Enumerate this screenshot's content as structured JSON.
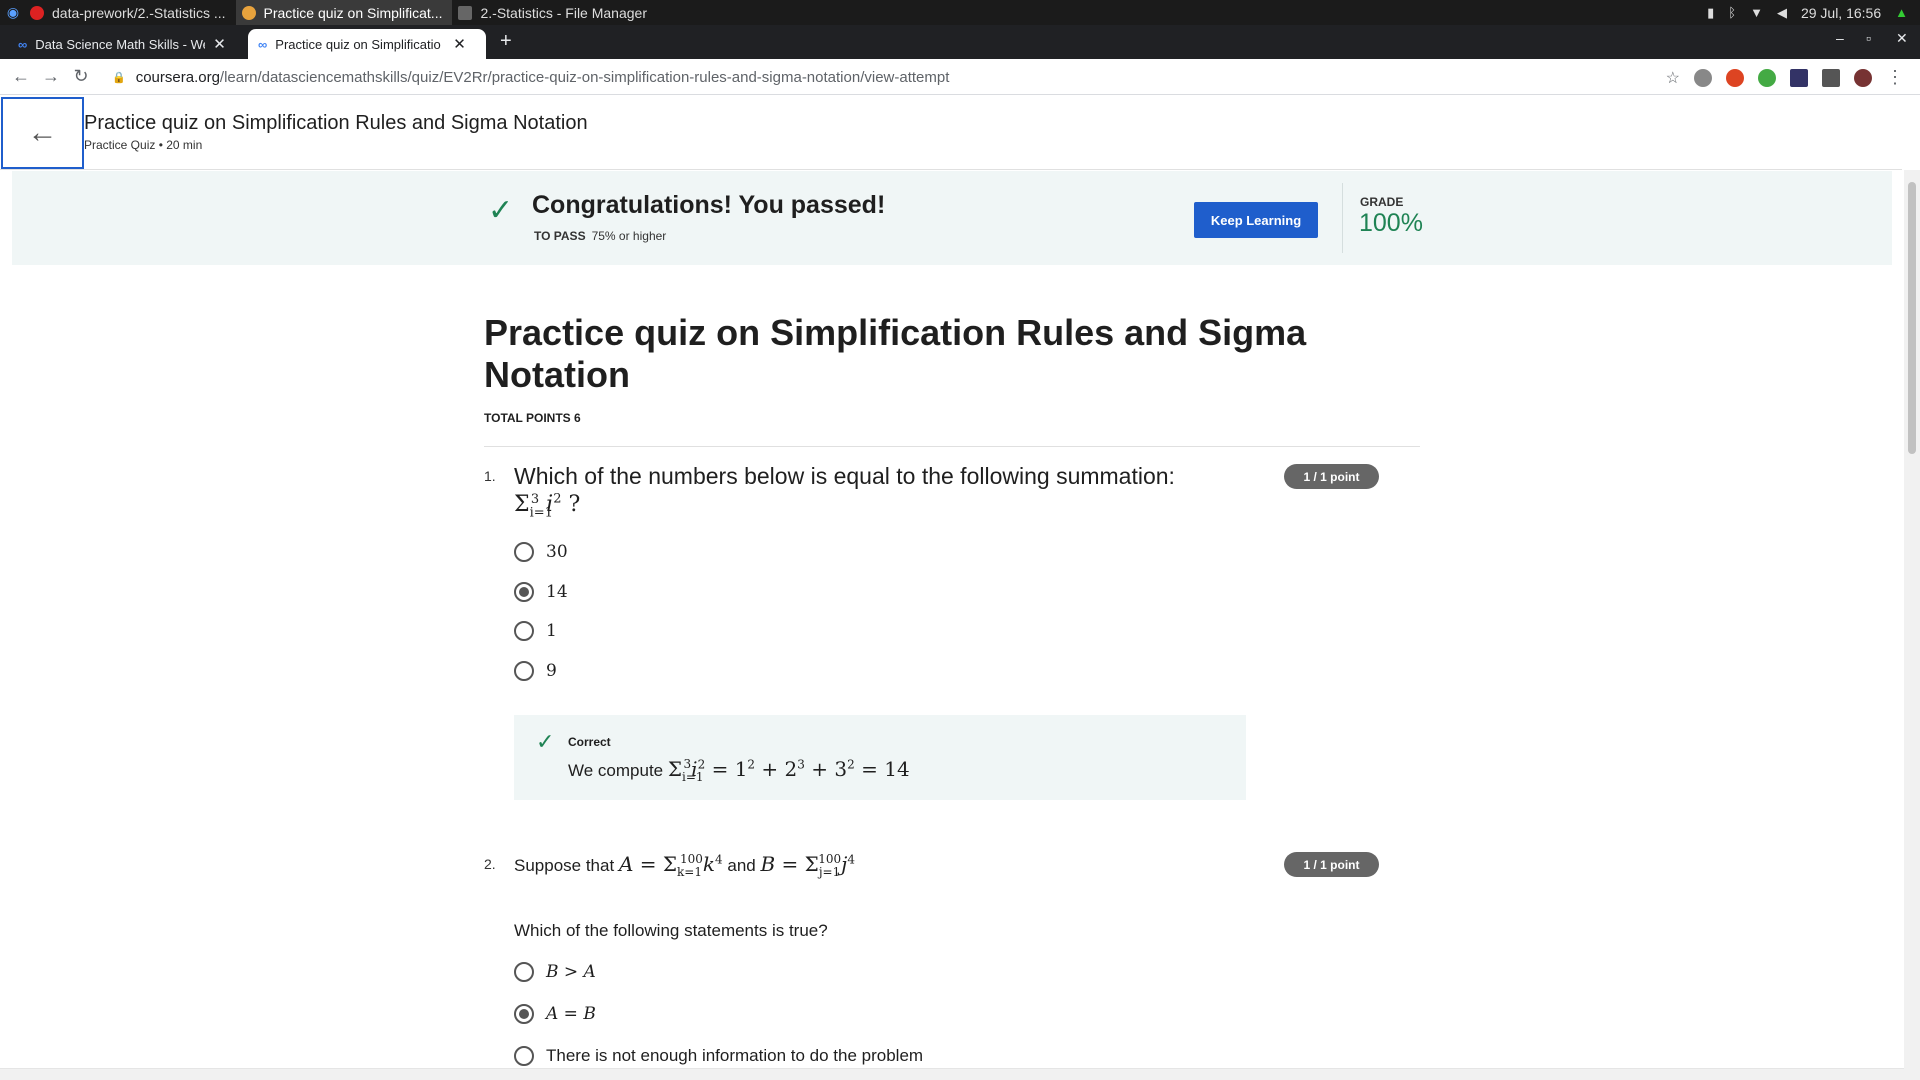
{
  "os": {
    "tasks": [
      {
        "label": "data-prework/2.-Statistics ..."
      },
      {
        "label": "Practice quiz on Simplificat..."
      },
      {
        "label": "2.-Statistics - File Manager"
      }
    ],
    "clock": "29 Jul, 16:56"
  },
  "browser": {
    "tabs": [
      {
        "label": "Data Science Math Skills - Wel"
      },
      {
        "label": "Practice quiz on Simplificatio"
      }
    ],
    "url_host": "coursera.org",
    "url_path": "/learn/datasciencemathskills/quiz/EV2Rr/practice-quiz-on-simplification-rules-and-sigma-notation/view-attempt"
  },
  "header": {
    "title": "Practice quiz on Simplification Rules and Sigma Notation",
    "subtitle": "Practice Quiz • 20 min"
  },
  "banner": {
    "message": "Congratulations! You passed!",
    "to_pass_label": "TO PASS",
    "to_pass_value": "75% or higher",
    "keep_learning": "Keep Learning",
    "grade_label": "GRADE",
    "grade_value": "100%"
  },
  "quiz": {
    "title": "Practice quiz on Simplification Rules and Sigma Notation",
    "total_points": "TOTAL POINTS 6",
    "questions": [
      {
        "number": "1.",
        "text": "Which of the numbers below is equal to the following summation:",
        "badge": "1 / 1 point",
        "options": [
          "30",
          "14",
          "1",
          "9"
        ],
        "selected": 1,
        "feedback_title": "Correct",
        "feedback_prefix": "We compute"
      },
      {
        "number": "2.",
        "text_prefix": "Suppose that",
        "text_and": "and",
        "badge": "1 / 1 point",
        "sub": "Which of the following statements is true?",
        "options": [
          "B > A",
          "A = B",
          "There is not enough information to do the problem"
        ],
        "selected": 1
      }
    ]
  },
  "colors": {
    "accent": "#1f5ecc",
    "success": "#1f8354",
    "banner_bg": "#f0f6f6",
    "badge_bg": "#666666"
  }
}
